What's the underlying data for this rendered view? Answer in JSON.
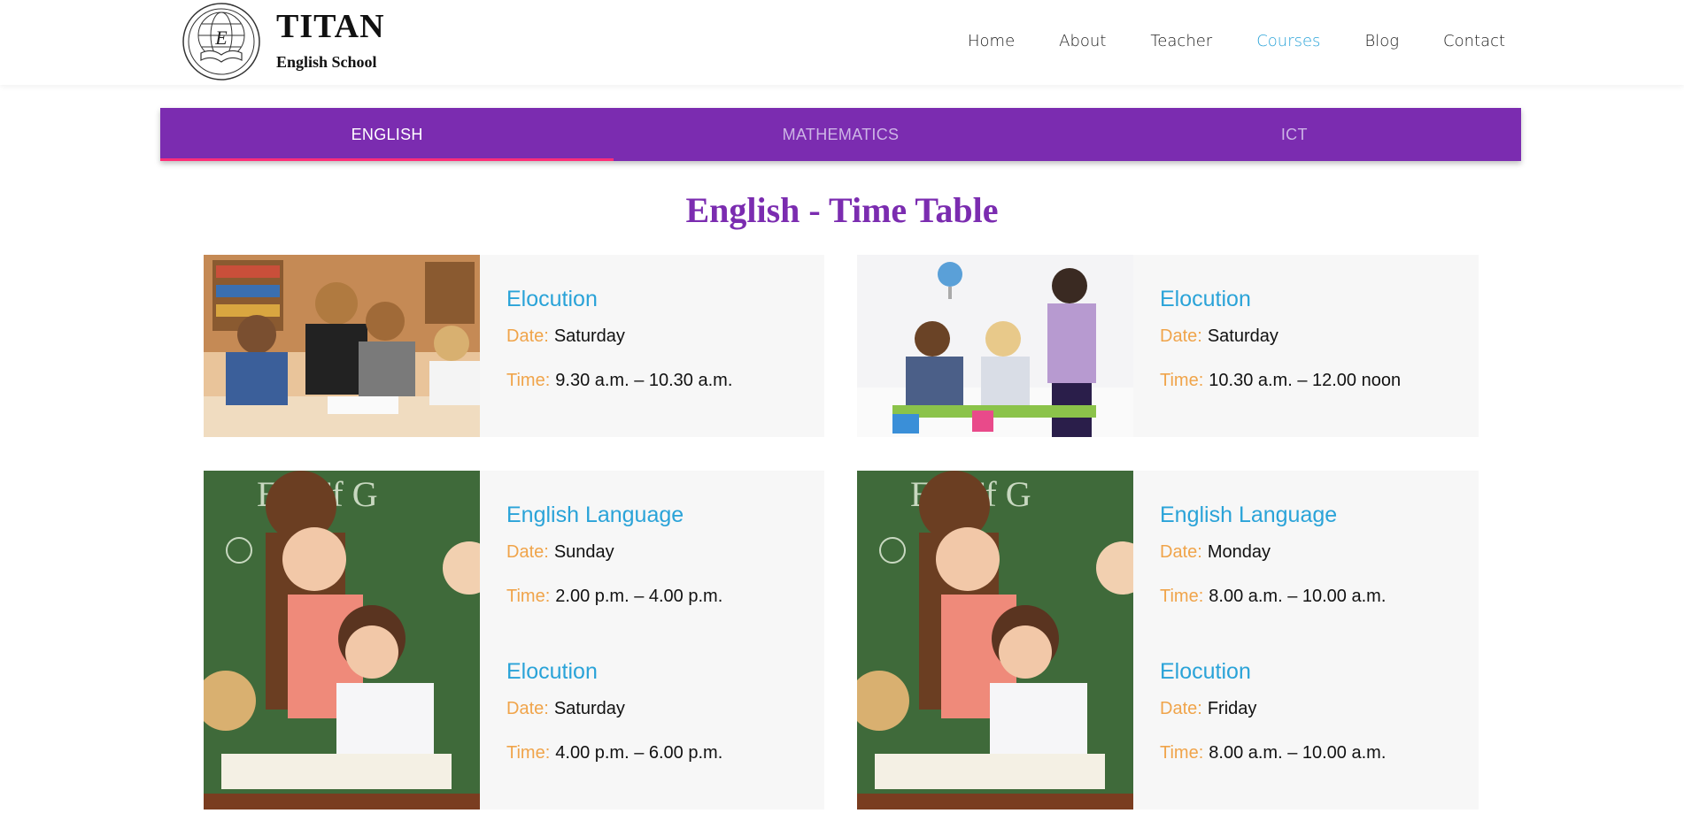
{
  "header": {
    "brand_title": "TITAN",
    "brand_subtitle": "English School",
    "logo_letter": "E",
    "nav": [
      {
        "label": "Home",
        "active": false
      },
      {
        "label": "About",
        "active": false
      },
      {
        "label": "Teacher",
        "active": false
      },
      {
        "label": "Courses",
        "active": true
      },
      {
        "label": "Blog",
        "active": false
      },
      {
        "label": "Contact",
        "active": false
      }
    ]
  },
  "tabs": [
    {
      "label": "ENGLISH",
      "active": true
    },
    {
      "label": "MATHEMATICS",
      "active": false
    },
    {
      "label": "ICT",
      "active": false
    }
  ],
  "page_title": "English - Time Table",
  "labels": {
    "date": "Date:",
    "time": "Time:"
  },
  "cards": [
    {
      "sessions": [
        {
          "title": "Elocution",
          "date": "Saturday",
          "time": "9.30 a.m. – 10.30 a.m."
        }
      ]
    },
    {
      "sessions": [
        {
          "title": "Elocution",
          "date": "Saturday",
          "time": "10.30 a.m. – 12.00 noon"
        }
      ]
    },
    {
      "sessions": [
        {
          "title": "English Language",
          "date": "Sunday",
          "time": "2.00 p.m. – 4.00 p.m."
        },
        {
          "title": "Elocution",
          "date": "Saturday",
          "time": "4.00 p.m. – 6.00 p.m."
        }
      ]
    },
    {
      "sessions": [
        {
          "title": "English Language",
          "date": "Monday",
          "time": "8.00 a.m. – 10.00 a.m."
        },
        {
          "title": "Elocution",
          "date": "Friday",
          "time": "8.00 a.m. – 10.00 a.m."
        }
      ]
    }
  ],
  "colors": {
    "accent_purple": "#7b2cb0",
    "link_blue": "#2aa3d8",
    "label_orange": "#f0a44a",
    "tab_underline": "#ff2d78"
  }
}
